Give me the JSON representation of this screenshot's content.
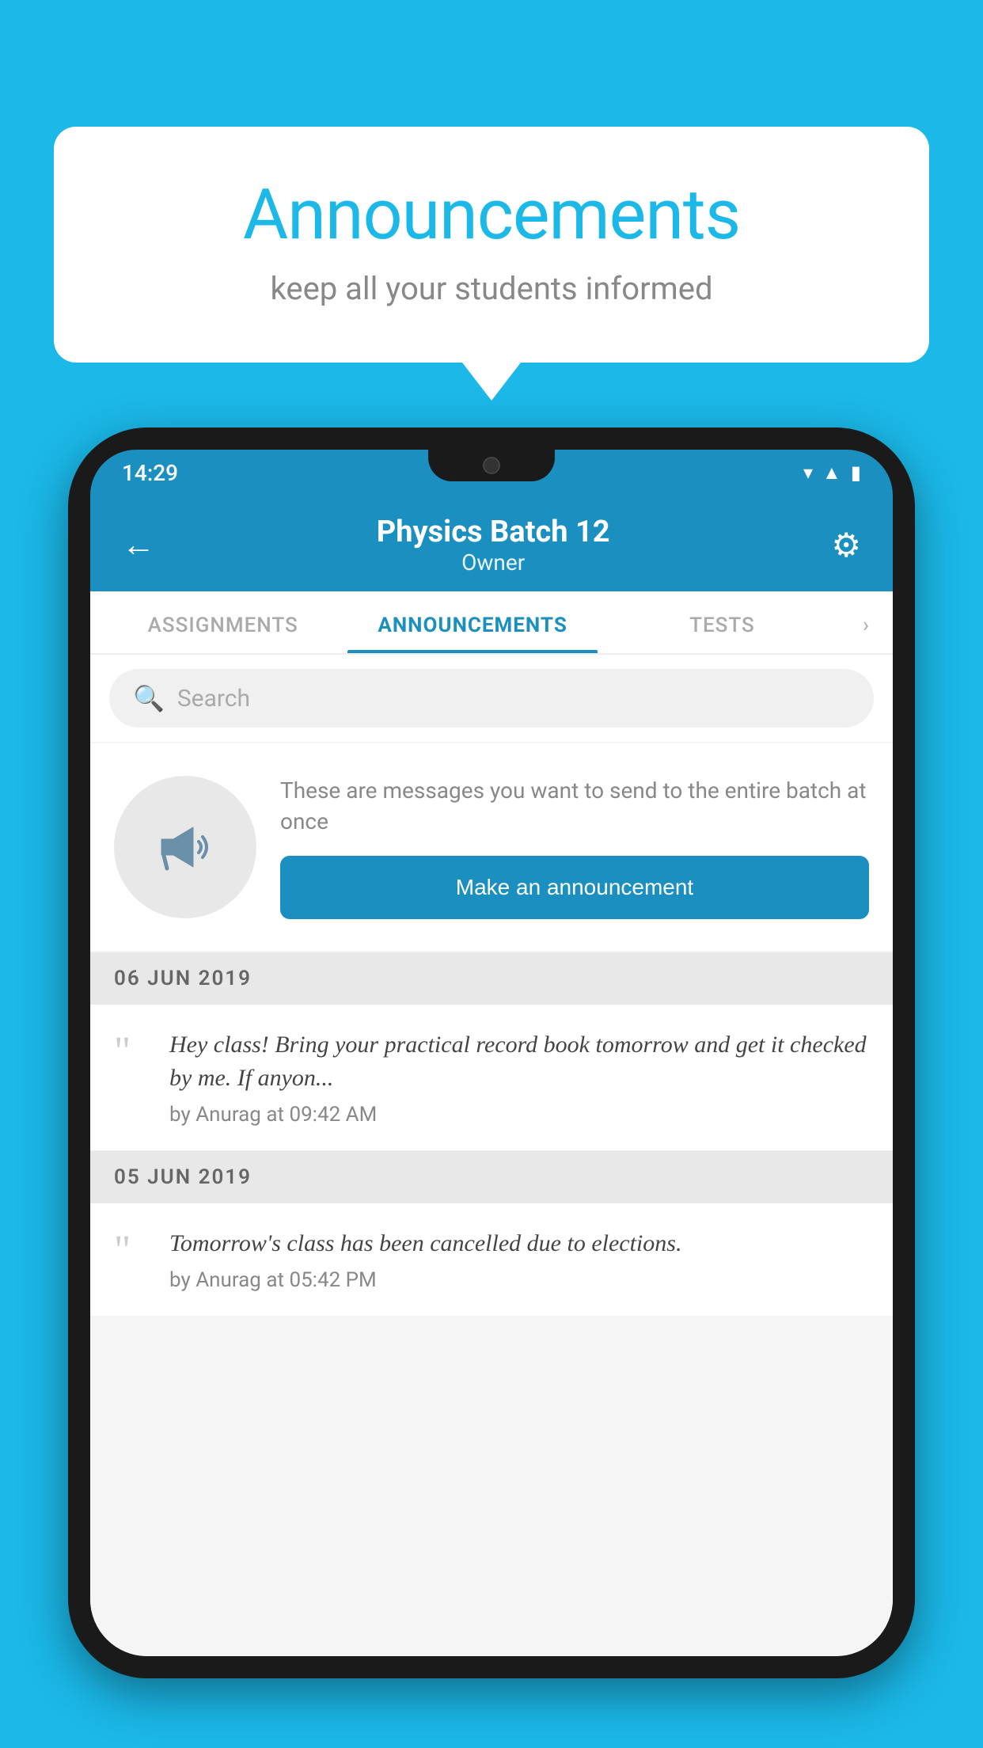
{
  "background_color": "#1bb8e8",
  "speech_bubble": {
    "title": "Announcements",
    "subtitle": "keep all your students informed"
  },
  "status_bar": {
    "time": "14:29",
    "wifi": "▾",
    "signal": "▲",
    "battery": "▮"
  },
  "app_header": {
    "back_arrow": "←",
    "title": "Physics Batch 12",
    "subtitle": "Owner",
    "gear": "⚙"
  },
  "tabs": [
    {
      "label": "ASSIGNMENTS",
      "active": false
    },
    {
      "label": "ANNOUNCEMENTS",
      "active": true
    },
    {
      "label": "TESTS",
      "active": false
    }
  ],
  "tabs_more": "›",
  "search": {
    "placeholder": "Search"
  },
  "promo": {
    "text": "These are messages you want to send to the entire batch at once",
    "button_label": "Make an announcement"
  },
  "announcements": [
    {
      "date_label": "06  JUN  2019",
      "text": "Hey class! Bring your practical record book tomorrow and get it checked by me. If anyon...",
      "meta": "by Anurag at 09:42 AM"
    },
    {
      "date_label": "05  JUN  2019",
      "text": "Tomorrow's class has been cancelled due to elections.",
      "meta": "by Anurag at 05:42 PM"
    }
  ]
}
